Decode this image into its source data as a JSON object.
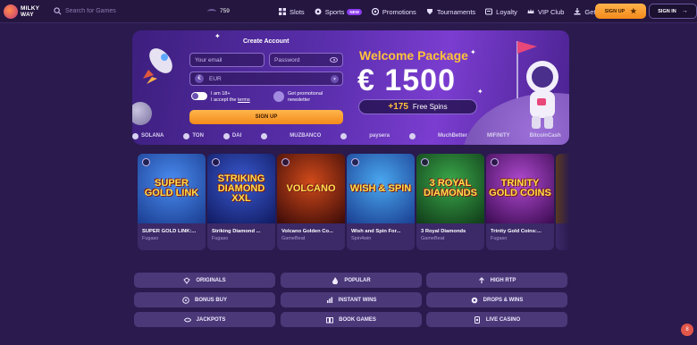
{
  "header": {
    "logo_line1": "MILKY",
    "logo_line2": "WAY",
    "search_placeholder": "Search for Games",
    "online_count": "759",
    "nav": [
      {
        "label": "Slots",
        "icon": "grid-icon"
      },
      {
        "label": "Sports",
        "icon": "ball-icon",
        "badge": "NEW"
      },
      {
        "label": "Promotions",
        "icon": "gift-icon"
      },
      {
        "label": "Tournaments",
        "icon": "trophy-icon"
      },
      {
        "label": "Loyalty",
        "icon": "star-icon"
      },
      {
        "label": "VIP Club",
        "icon": "crown-icon"
      },
      {
        "label": "Get App",
        "icon": "download-icon"
      }
    ],
    "signup_label": "SIGN UP",
    "signin_label": "SIGN IN"
  },
  "banner": {
    "form_title": "Create Account",
    "email_placeholder": "Your email",
    "password_placeholder": "Password",
    "currency_value": "EUR",
    "age_line1": "I am 18+",
    "age_line2": "I accept the",
    "terms_link": "terms",
    "promo_line1": "Get promotional",
    "promo_line2": "newsletter",
    "signup_button": "SIGN UP",
    "welcome_title": "Welcome Package",
    "welcome_amount": "€ 1500",
    "spins_count": "+175",
    "spins_label": "Free Spins",
    "accent_color": "#ffc23a"
  },
  "providers": [
    "SOLANA",
    "TON",
    "DAI",
    "",
    "MUZBANCO",
    "",
    "paysera",
    "",
    "MuchBetter",
    "MIFINITY",
    "BitcoinCash"
  ],
  "games": [
    {
      "title": "SUPER GOLD LINK",
      "name": "SUPER GOLD LINK:...",
      "provider": "Fugaso",
      "color": "#2b6bd0"
    },
    {
      "title": "STRIKING DIAMOND XXL",
      "name": "Striking Diamond ...",
      "provider": "Fugaso",
      "color": "#1a3da0"
    },
    {
      "title": "VOLCANO",
      "name": "Volcano Golden Co...",
      "provider": "GameBeat",
      "color": "#8a2a14"
    },
    {
      "title": "WISH & SPIN",
      "name": "Wish and Spin For...",
      "provider": "Spin4win",
      "color": "#1f7ad6"
    },
    {
      "title": "3 ROYAL DIAMONDS",
      "name": "3 Royal Diamonds",
      "provider": "GameBeat",
      "color": "#2a8a3a"
    },
    {
      "title": "TRINITY GOLD COINS",
      "name": "Trinity Gold Coins:...",
      "provider": "Fugaso",
      "color": "#7a1aa0"
    }
  ],
  "categories": [
    {
      "label": "ORIGINALS",
      "icon": "diamond-icon"
    },
    {
      "label": "POPULAR",
      "icon": "flame-icon"
    },
    {
      "label": "HIGH RTP",
      "icon": "arrow-up-icon"
    },
    {
      "label": "BONUS BUY",
      "icon": "coin-icon"
    },
    {
      "label": "INSTANT WINS",
      "icon": "bolt-icon"
    },
    {
      "label": "DROPS & WINS",
      "icon": "drop-icon"
    },
    {
      "label": "JACKPOTS",
      "icon": "chip-icon"
    },
    {
      "label": "BOOK GAMES",
      "icon": "book-icon"
    },
    {
      "label": "LIVE CASINO",
      "icon": "cards-icon"
    }
  ],
  "chat_label": "8"
}
